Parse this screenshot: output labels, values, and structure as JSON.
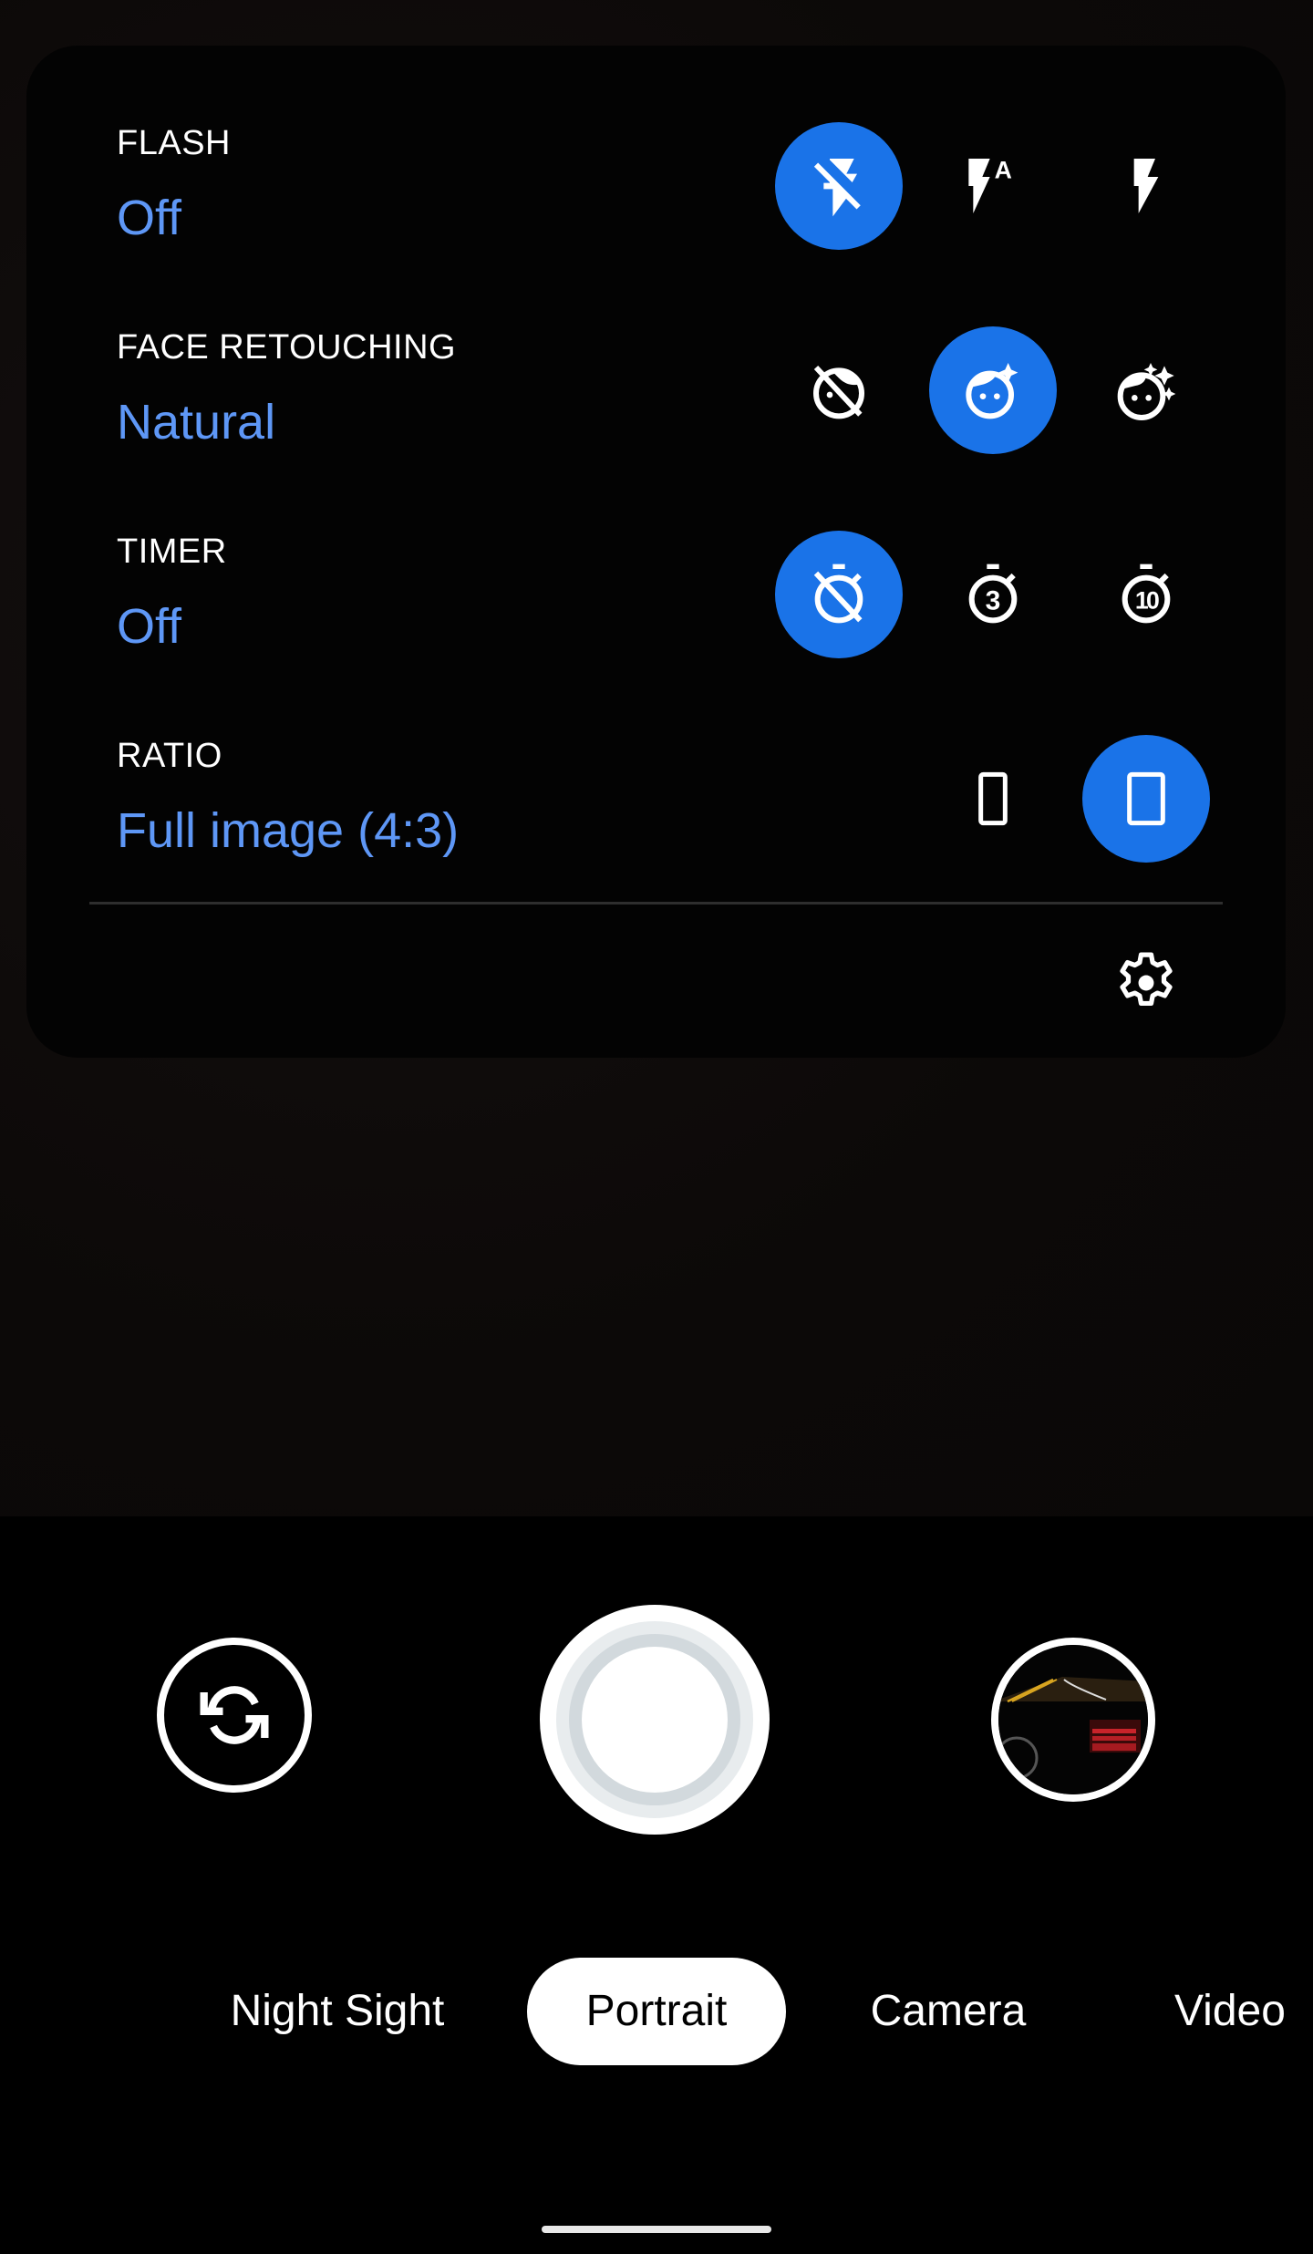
{
  "app": "Camera",
  "colors": {
    "accent": "#1a73e8",
    "value_text": "#5e97f6",
    "panel_bg": "#030303",
    "divider": "#2e2e2e"
  },
  "settings": {
    "flash": {
      "label": "FLASH",
      "value": "Off",
      "options": [
        {
          "name": "flash-off",
          "icon": "flash-off-icon",
          "selected": true
        },
        {
          "name": "flash-auto",
          "icon": "flash-auto-icon",
          "selected": false
        },
        {
          "name": "flash-on",
          "icon": "flash-on-icon",
          "selected": false
        }
      ]
    },
    "face_retouching": {
      "label": "FACE RETOUCHING",
      "value": "Natural",
      "options": [
        {
          "name": "retouch-off",
          "icon": "face-retouching-off-icon",
          "selected": false
        },
        {
          "name": "retouch-natural",
          "icon": "face-retouching-natural-icon",
          "selected": true
        },
        {
          "name": "retouch-smooth",
          "icon": "face-retouching-smooth-icon",
          "selected": false
        }
      ]
    },
    "timer": {
      "label": "TIMER",
      "value": "Off",
      "options": [
        {
          "name": "timer-off",
          "icon": "timer-off-icon",
          "selected": true
        },
        {
          "name": "timer-3",
          "icon": "timer-3-icon",
          "label": "3",
          "selected": false
        },
        {
          "name": "timer-10",
          "icon": "timer-10-icon",
          "label": "10",
          "selected": false
        }
      ]
    },
    "ratio": {
      "label": "RATIO",
      "value": "Full image (4:3)",
      "options": [
        {
          "name": "ratio-wide",
          "icon": "ratio-tall-rect-icon",
          "selected": false
        },
        {
          "name": "ratio-full",
          "icon": "ratio-4-3-rect-icon",
          "selected": true
        }
      ]
    },
    "more_settings_icon": "gear-icon"
  },
  "controls": {
    "flip_camera_icon": "flip-camera-icon",
    "shutter": "shutter-button",
    "gallery_thumbnail": "last-photo-thumbnail"
  },
  "modes": [
    {
      "label": "Night Sight",
      "active": false
    },
    {
      "label": "Portrait",
      "active": true
    },
    {
      "label": "Camera",
      "active": false
    },
    {
      "label": "Video",
      "active": false
    }
  ]
}
